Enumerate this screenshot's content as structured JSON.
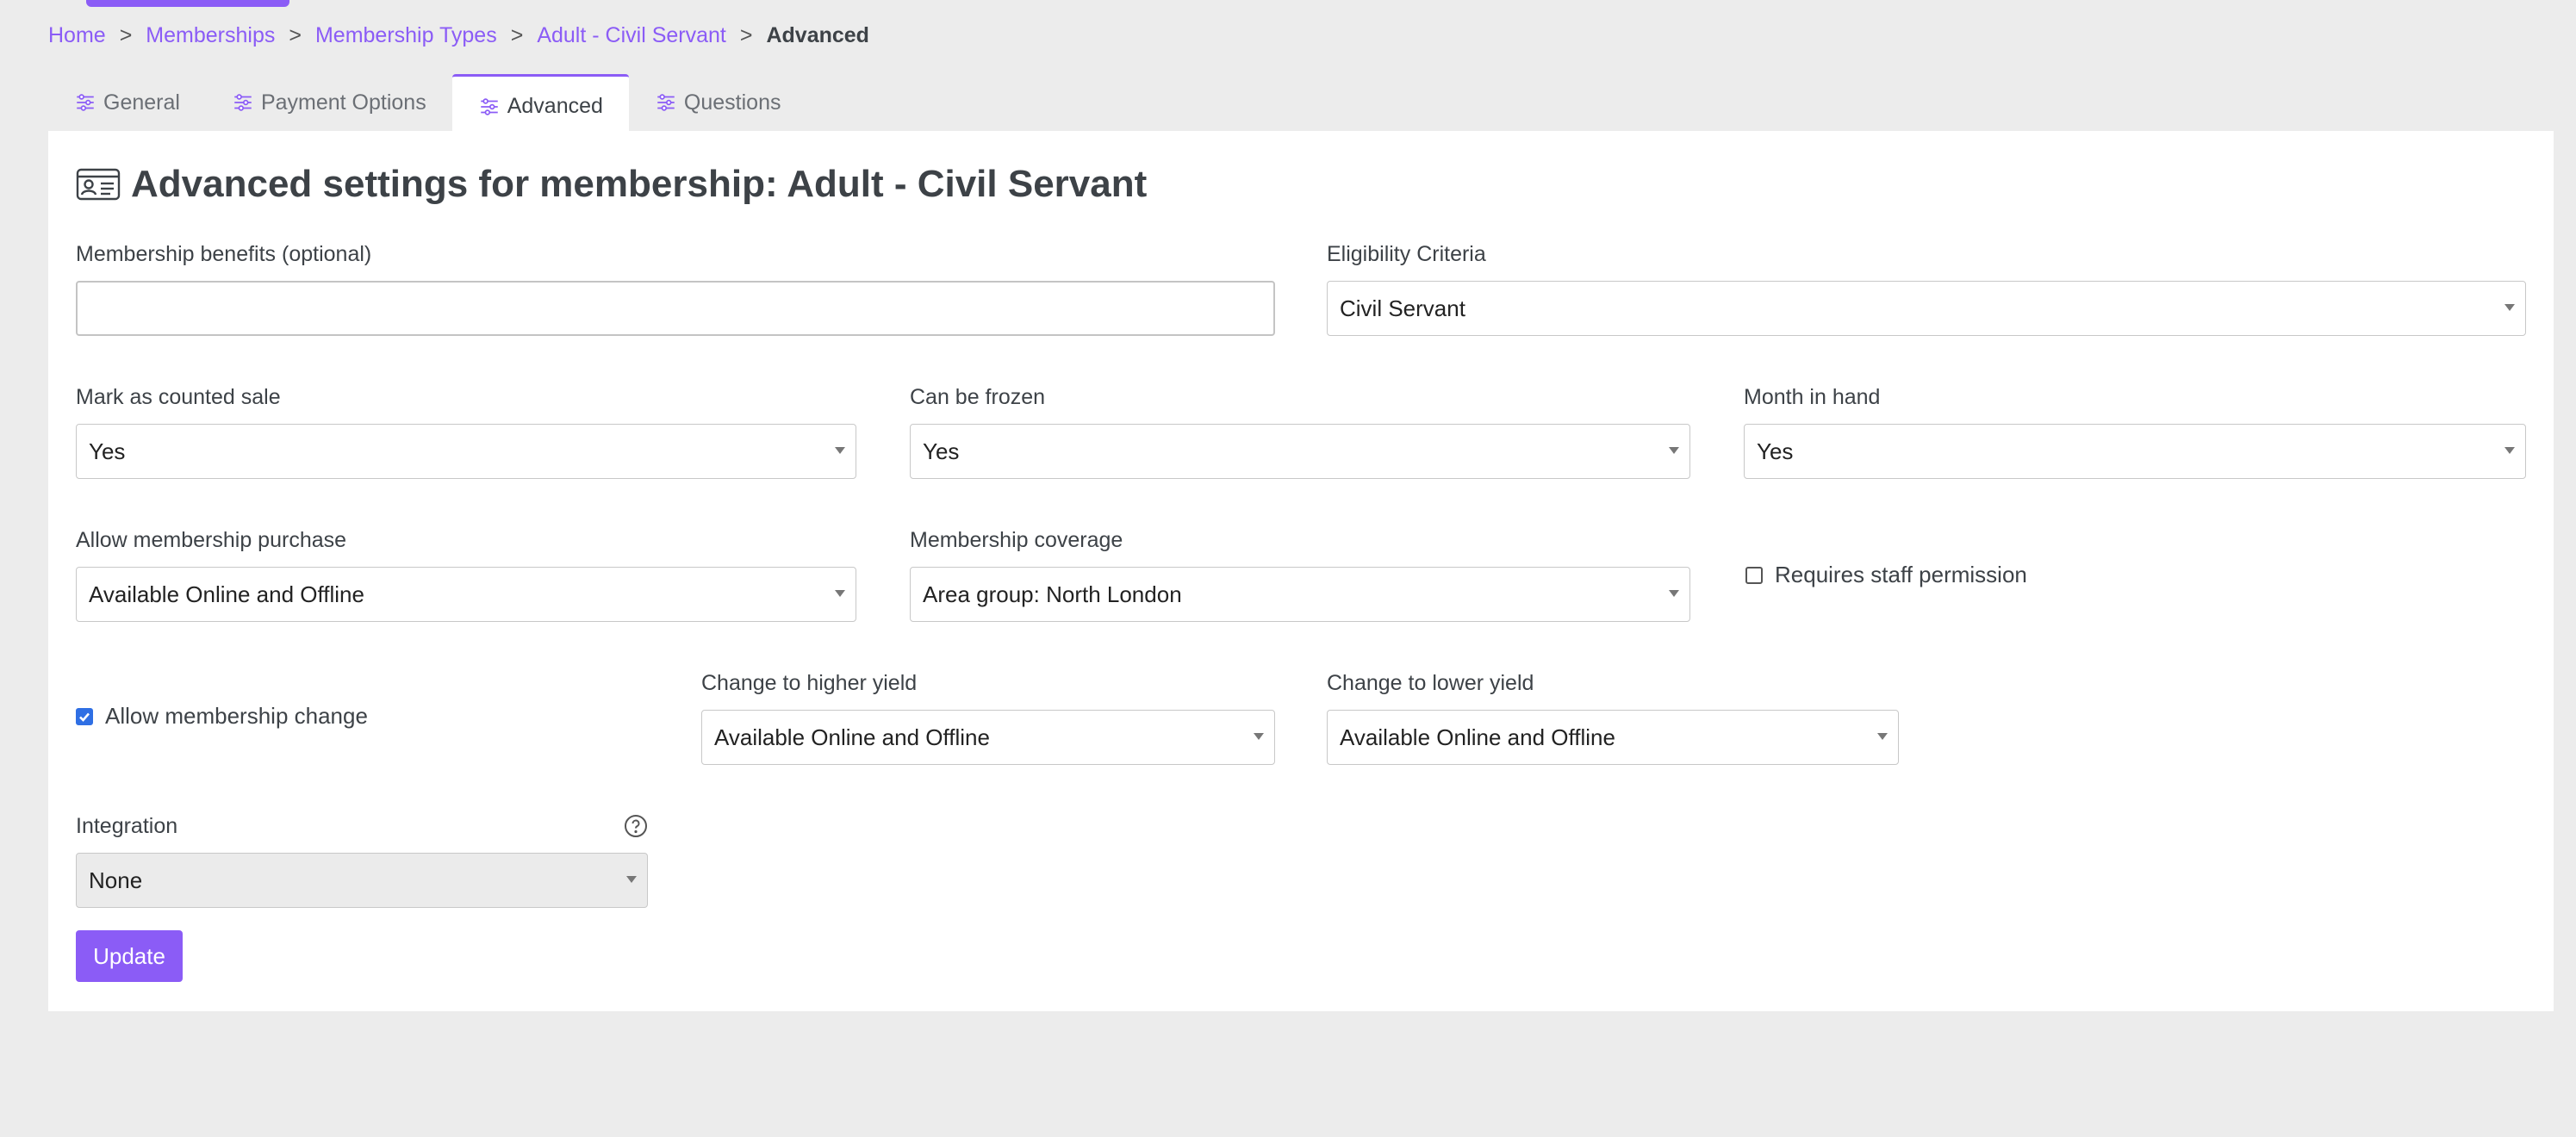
{
  "breadcrumb": {
    "items": [
      "Home",
      "Memberships",
      "Membership Types",
      "Adult - Civil Servant"
    ],
    "current": "Advanced",
    "separator": ">"
  },
  "tabs": [
    "General",
    "Payment Options",
    "Advanced",
    "Questions"
  ],
  "active_tab": "Advanced",
  "page": {
    "icon": "id-card-icon",
    "title": "Advanced settings for membership: Adult - Civil Servant"
  },
  "form": {
    "benefits": {
      "label": "Membership benefits (optional)",
      "value": ""
    },
    "eligibility": {
      "label": "Eligibility Criteria",
      "value": "Civil Servant"
    },
    "counted_sale": {
      "label": "Mark as counted sale",
      "value": "Yes"
    },
    "can_be_frozen": {
      "label": "Can be frozen",
      "value": "Yes"
    },
    "month_in_hand": {
      "label": "Month in hand",
      "value": "Yes"
    },
    "allow_purchase": {
      "label": "Allow membership purchase",
      "value": "Available Online and Offline"
    },
    "coverage": {
      "label": "Membership coverage",
      "value": "Area group: North London"
    },
    "requires_staff_permission": {
      "label": "Requires staff permission",
      "checked": false
    },
    "allow_change": {
      "label": "Allow membership change",
      "checked": true
    },
    "higher_yield": {
      "label": "Change to higher yield",
      "value": "Available Online and Offline"
    },
    "lower_yield": {
      "label": "Change to lower yield",
      "value": "Available Online and Offline"
    },
    "integration": {
      "label": "Integration",
      "value": "None"
    },
    "update_label": "Update"
  },
  "colors": {
    "accent": "#8b5cf6",
    "checkbox_checked": "#2f6fe4",
    "background": "#ececec"
  }
}
